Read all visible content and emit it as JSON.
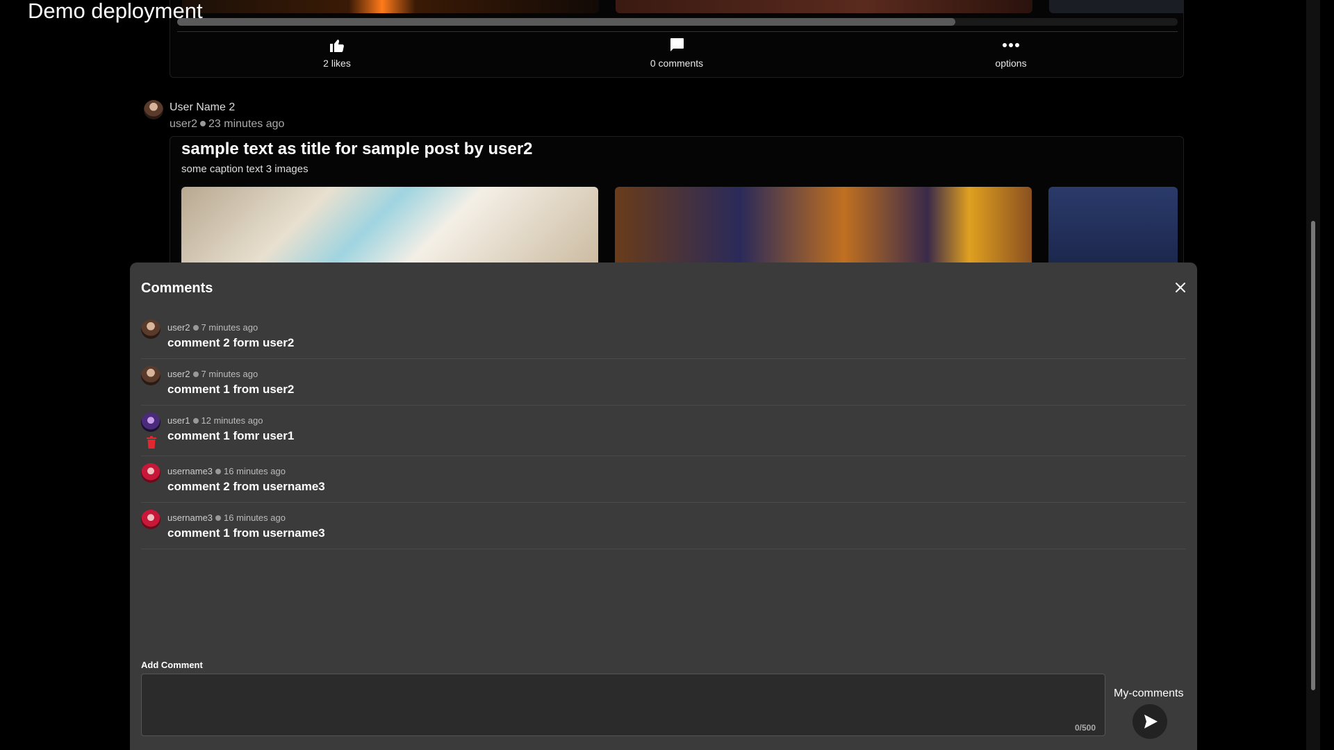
{
  "app": {
    "title": "Demo deployment"
  },
  "previous_post": {
    "actions": {
      "likes": "2 likes",
      "comments": "0 comments",
      "options": "options"
    }
  },
  "post": {
    "display_name": "User Name 2",
    "username": "user2",
    "time": "23 minutes ago",
    "title": "sample text as title for sample post by user2",
    "caption": "some caption text 3 images"
  },
  "comments_panel": {
    "title": "Comments",
    "comments": [
      {
        "user": "user2",
        "time": "7 minutes ago",
        "text": "comment 2 form user2",
        "avatar": "brown"
      },
      {
        "user": "user2",
        "time": "7 minutes ago",
        "text": "comment 1 from user2",
        "avatar": "brown"
      },
      {
        "user": "user1",
        "time": "12 minutes ago",
        "text": "comment 1 fomr user1",
        "avatar": "purple",
        "deletable": true
      },
      {
        "user": "username3",
        "time": "16 minutes ago",
        "text": "comment 2 from username3",
        "avatar": "red"
      },
      {
        "user": "username3",
        "time": "16 minutes ago",
        "text": "comment 1 from username3",
        "avatar": "red"
      }
    ],
    "add_label": "Add Comment",
    "input_value": "",
    "counter": "0/500",
    "my_comments": "My-comments"
  },
  "colors": {
    "background": "#000000",
    "sheet": "#3b3b3b",
    "delete": "#e0282e"
  },
  "icons": [
    "thumbs-up-icon",
    "comment-icon",
    "more-options-icon",
    "close-icon",
    "trash-icon",
    "send-icon"
  ]
}
